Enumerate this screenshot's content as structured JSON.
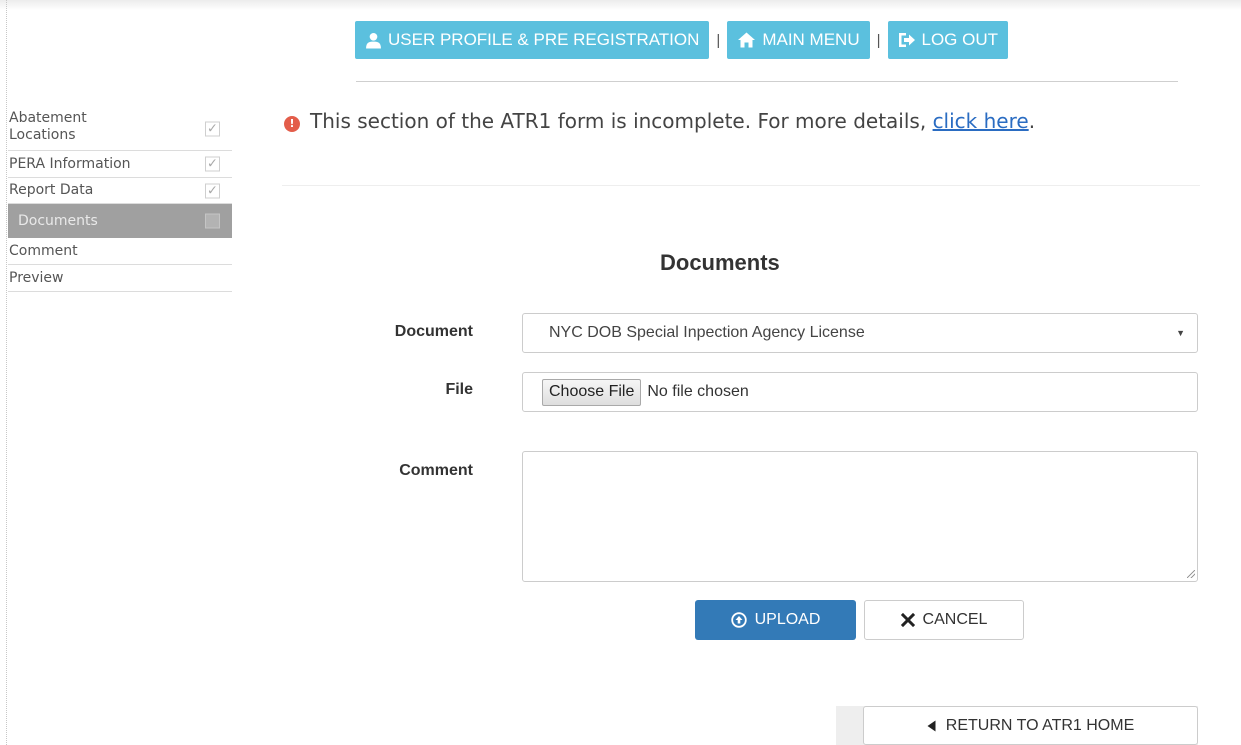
{
  "nav": {
    "profile_label": "USER PROFILE & PRE REGISTRATION",
    "main_menu_label": "MAIN MENU",
    "logout_label": "LOG OUT",
    "separator": "|"
  },
  "sidebar": {
    "items": [
      {
        "label": "Abatement Locations",
        "checked": true
      },
      {
        "label": "PERA Information",
        "checked": true
      },
      {
        "label": "Report Data",
        "checked": true
      },
      {
        "label": "Documents",
        "checked": false,
        "active": true
      },
      {
        "label": "Comment"
      },
      {
        "label": "Preview"
      }
    ]
  },
  "alert": {
    "icon": "!",
    "text": "This section of the ATR1 form is incomplete. For more details, ",
    "link_text": "click here",
    "suffix": "."
  },
  "section": {
    "title": "Documents"
  },
  "form": {
    "document_label": "Document",
    "document_selected": "NYC DOB Special Inpection Agency License",
    "file_label": "File",
    "choose_file_label": "Choose File",
    "file_status": "No file chosen",
    "comment_label": "Comment",
    "comment_value": ""
  },
  "buttons": {
    "upload_label": "UPLOAD",
    "cancel_label": "CANCEL",
    "return_label": "RETURN TO ATR1 HOME"
  },
  "colors": {
    "info": "#5bc0de",
    "primary": "#337ab7",
    "link": "#2a6cc2",
    "alert_icon": "#e35d4a",
    "sidebar_active": "#a0a0a0"
  }
}
